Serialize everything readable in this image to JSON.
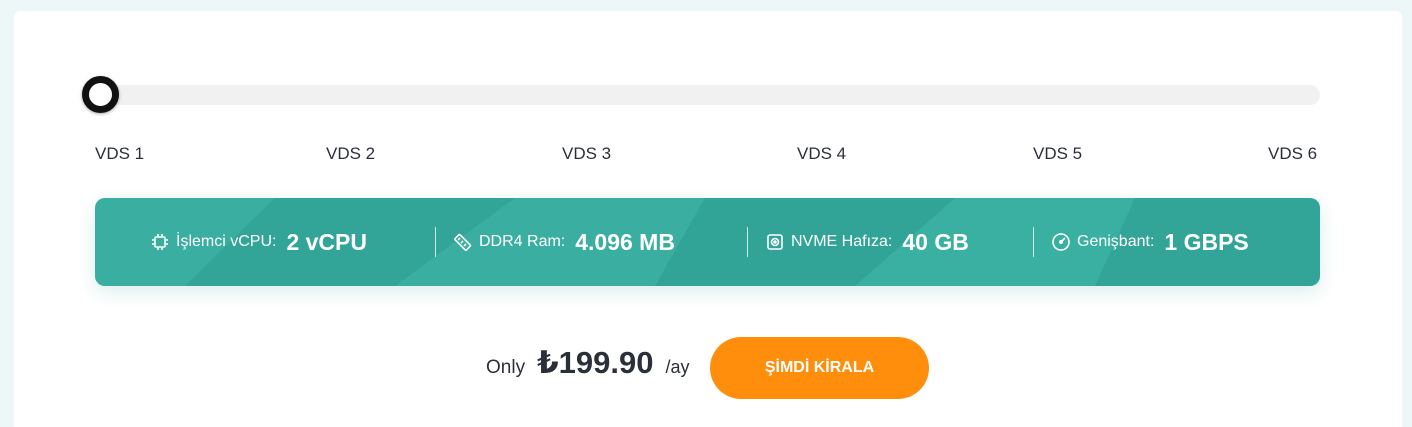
{
  "slider": {
    "ticks": [
      "VDS 1",
      "VDS 2",
      "VDS 3",
      "VDS 4",
      "VDS 5",
      "VDS 6"
    ],
    "selected_index": 0
  },
  "specs": [
    {
      "icon": "cpu-icon",
      "label": "İşlemci vCPU:",
      "value": "2 vCPU"
    },
    {
      "icon": "memory-icon",
      "label": "DDR4 Ram:",
      "value": "4.096 MB"
    },
    {
      "icon": "disk-icon",
      "label": "NVME Hafıza:",
      "value": "40 GB"
    },
    {
      "icon": "speedometer-icon",
      "label": "Genişbant:",
      "value": "1 GBPS"
    }
  ],
  "pricing": {
    "prefix": "Only",
    "amount": "₺199.90",
    "period": "/ay",
    "button_label": "ŞİMDİ KİRALA"
  },
  "colors": {
    "accent": "#34a99c",
    "button": "#ff8e0c",
    "thumb_border": "#111111",
    "track": "#f1f1f1"
  }
}
